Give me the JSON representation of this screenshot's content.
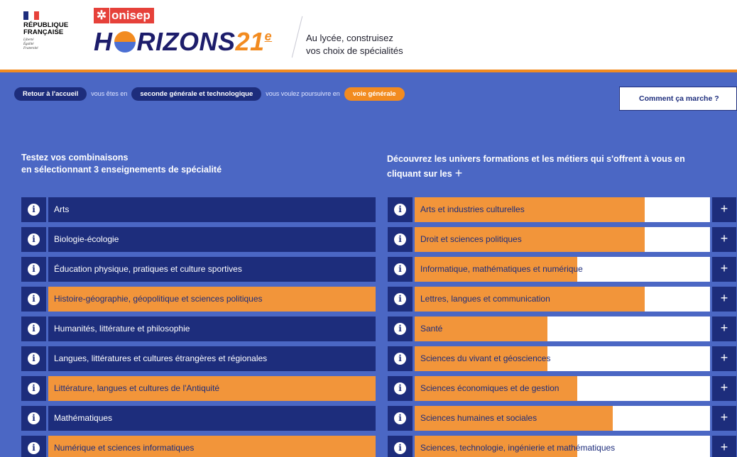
{
  "header": {
    "rf_title_line1": "RÉPUBLIQUE",
    "rf_title_line2": "FRANÇAISE",
    "rf_motto_line1": "Liberté",
    "rf_motto_line2": "Égalité",
    "rf_motto_line3": "Fraternité",
    "onisep": "onisep",
    "brand_left": "H",
    "brand_right": "RIZONS",
    "brand_num": "21",
    "brand_sup": "e",
    "tagline_line1": "Au lycée, construisez",
    "tagline_line2": "vos choix de spécialités"
  },
  "colors": {
    "primary_navy": "#1d2d7c",
    "panel_blue": "#4b67c4",
    "orange": "#f2953a",
    "red": "#e6413a"
  },
  "nav": {
    "back_label": "Retour à l'accueil",
    "you_are_in": "vous êtes en",
    "current_level": "seconde générale et technologique",
    "you_want": "vous voulez poursuivre en",
    "target_path": "voie générale",
    "how_it_works": "Comment ça marche ?"
  },
  "left_panel": {
    "heading_line1": "Testez vos combinaisons",
    "heading_line2": "en sélectionnant 3 enseignements de spécialité",
    "items": [
      {
        "label": "Arts",
        "selected": false
      },
      {
        "label": "Biologie-écologie",
        "selected": false
      },
      {
        "label": "Éducation physique, pratiques et culture sportives",
        "selected": false
      },
      {
        "label": "Histoire-géographie, géopolitique et sciences politiques",
        "selected": true
      },
      {
        "label": "Humanités, littérature et philosophie",
        "selected": false
      },
      {
        "label": "Langues, littératures et cultures étrangères et régionales",
        "selected": false
      },
      {
        "label": "Littérature, langues et cultures de l'Antiquité",
        "selected": true
      },
      {
        "label": "Mathématiques",
        "selected": false
      },
      {
        "label": "Numérique et sciences informatiques",
        "selected": true
      }
    ]
  },
  "right_panel": {
    "heading_line1": "Découvrez les univers formations et les métiers qui s'offrent à vous en",
    "heading_line2": "cliquant sur les",
    "items": [
      {
        "label": "Arts et industries culturelles",
        "fill": 0.78
      },
      {
        "label": "Droit et sciences politiques",
        "fill": 0.78
      },
      {
        "label": "Informatique, mathématiques et numérique",
        "fill": 0.55
      },
      {
        "label": "Lettres, langues et communication",
        "fill": 0.78
      },
      {
        "label": "Santé",
        "fill": 0.45
      },
      {
        "label": "Sciences du vivant et géosciences",
        "fill": 0.45
      },
      {
        "label": "Sciences économiques et de gestion",
        "fill": 0.55
      },
      {
        "label": "Sciences humaines et sociales",
        "fill": 0.67
      },
      {
        "label": "Sciences, technologie, ingénierie et mathématiques",
        "fill": 0.55
      }
    ]
  },
  "icons": {
    "info": "i",
    "plus": "+",
    "onisep_star": "✲"
  }
}
